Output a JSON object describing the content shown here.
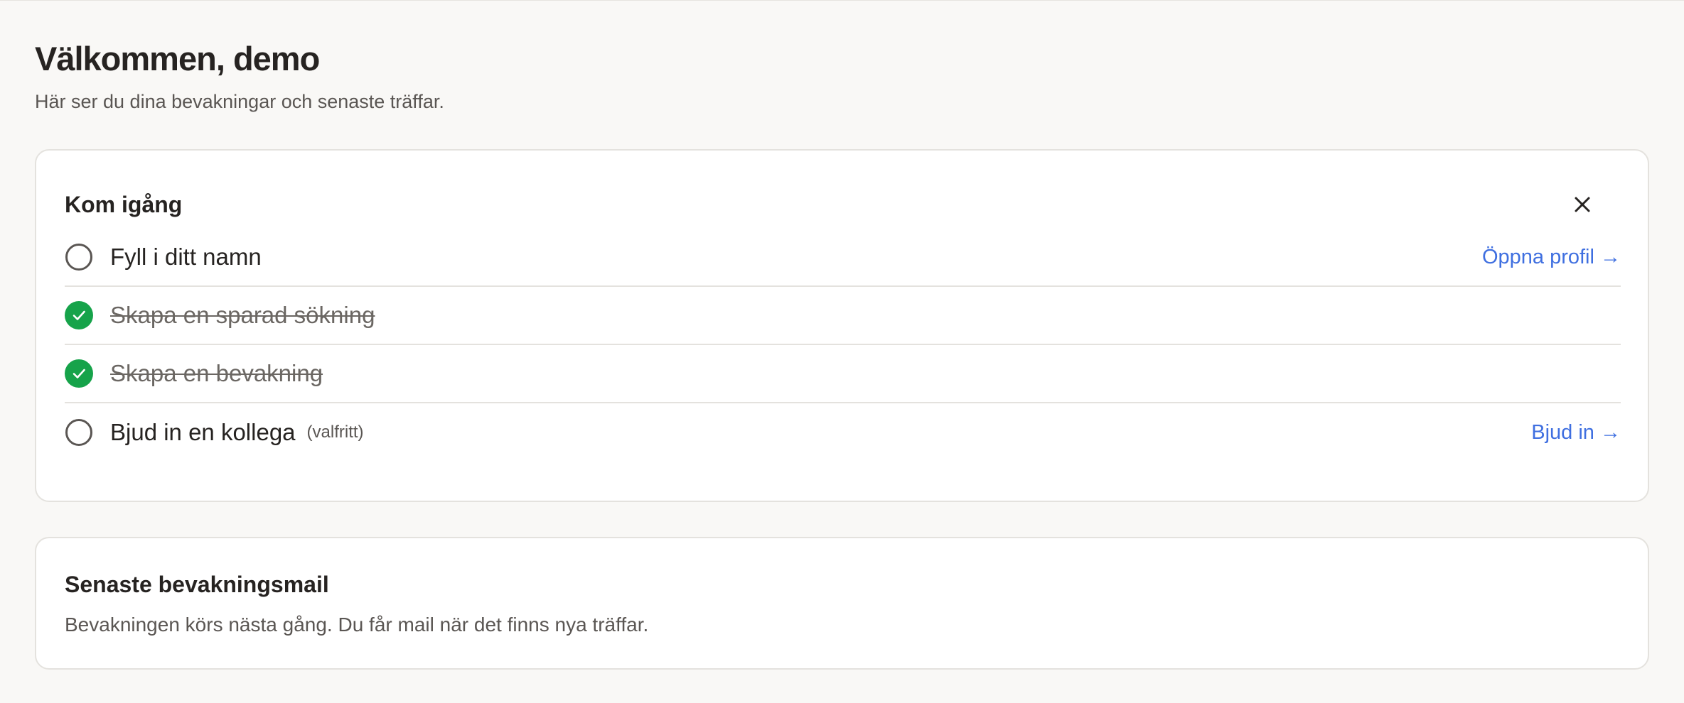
{
  "header": {
    "title": "Välkommen, demo",
    "subtitle": "Här ser du dina bevakningar och senaste träffar."
  },
  "onboarding": {
    "title": "Kom igång",
    "close_icon": "close-icon",
    "items": [
      {
        "label": "Fyll i ditt namn",
        "done": false,
        "note": "",
        "link": "Öppna profil →"
      },
      {
        "label": "Skapa en sparad sökning",
        "done": true,
        "note": "",
        "link": ""
      },
      {
        "label": "Skapa en bevakning",
        "done": true,
        "note": "",
        "link": ""
      },
      {
        "label": "Bjud in en kollega",
        "done": false,
        "note": "(valfritt)",
        "link": "Bjud in →"
      }
    ]
  },
  "latest_mail": {
    "title": "Senaste bevakningsmail",
    "text": "Bevakningen körs nästa gång. Du får mail när det finns nya träffar."
  },
  "colors": {
    "background": "#f9f8f6",
    "card": "#ffffff",
    "accent_link": "#3f6fe0",
    "done_green": "#16a34a",
    "border": "#e4e2de"
  }
}
